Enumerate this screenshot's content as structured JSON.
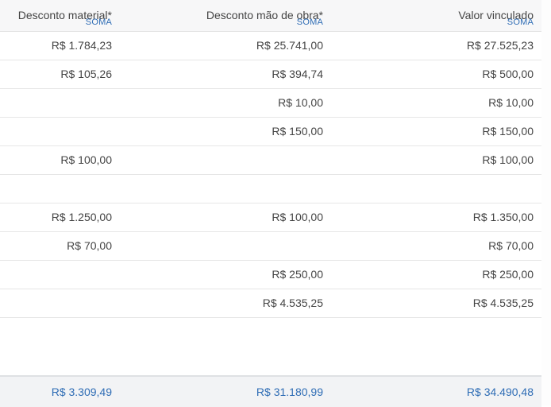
{
  "columns": [
    {
      "title": "Desconto material*",
      "aggregate": "SOMA"
    },
    {
      "title": "Desconto mão de obra*",
      "aggregate": "SOMA"
    },
    {
      "title": "Valor vinculado",
      "aggregate": "SOMA"
    }
  ],
  "rows": [
    [
      "R$ 1.784,23",
      "R$ 25.741,00",
      "R$ 27.525,23"
    ],
    [
      "R$ 105,26",
      "R$ 394,74",
      "R$ 500,00"
    ],
    [
      "",
      "R$ 10,00",
      "R$ 10,00"
    ],
    [
      "",
      "R$ 150,00",
      "R$ 150,00"
    ],
    [
      "R$ 100,00",
      "",
      "R$ 100,00"
    ],
    [
      "",
      "",
      ""
    ],
    [
      "R$ 1.250,00",
      "R$ 100,00",
      "R$ 1.350,00"
    ],
    [
      "R$ 70,00",
      "",
      "R$ 70,00"
    ],
    [
      "",
      "R$ 250,00",
      "R$ 250,00"
    ],
    [
      "",
      "R$ 4.535,25",
      "R$ 4.535,25"
    ]
  ],
  "totals": [
    "R$ 3.309,49",
    "R$ 31.180,99",
    "R$ 34.490,48"
  ]
}
